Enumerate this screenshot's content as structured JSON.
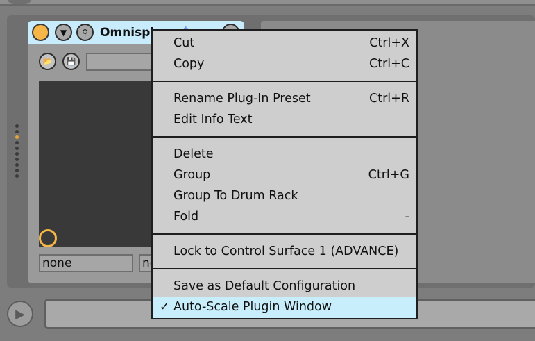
{
  "device": {
    "title": "Omnisph",
    "params": [
      "none",
      "no"
    ]
  },
  "context_menu": {
    "items": [
      {
        "label": "Cut",
        "shortcut": "Ctrl+X"
      },
      {
        "label": "Copy",
        "shortcut": "Ctrl+C"
      },
      {
        "label": "Rename Plug-In Preset",
        "shortcut": "Ctrl+R"
      },
      {
        "label": "Edit Info Text",
        "shortcut": ""
      },
      {
        "label": "Delete",
        "shortcut": ""
      },
      {
        "label": "Group",
        "shortcut": "Ctrl+G"
      },
      {
        "label": "Group To Drum Rack",
        "shortcut": ""
      },
      {
        "label": "Fold",
        "shortcut": "-"
      },
      {
        "label": "Lock to Control Surface 1 (ADVANCE)",
        "shortcut": ""
      },
      {
        "label": "Save as Default Configuration",
        "shortcut": ""
      },
      {
        "label": "Auto-Scale Plugin Window",
        "shortcut": "",
        "checked": true,
        "check_mark": "✓"
      }
    ]
  },
  "colors": {
    "menu_highlight": "#c8eefc",
    "device_header": "#c8ecfb",
    "accent_orange": "#f6b648"
  },
  "icons": {
    "fold_arrow": "▼",
    "hot_swap": "⚲",
    "folder": "📂",
    "save": "💾",
    "play": "▶",
    "mini": "⋔"
  }
}
